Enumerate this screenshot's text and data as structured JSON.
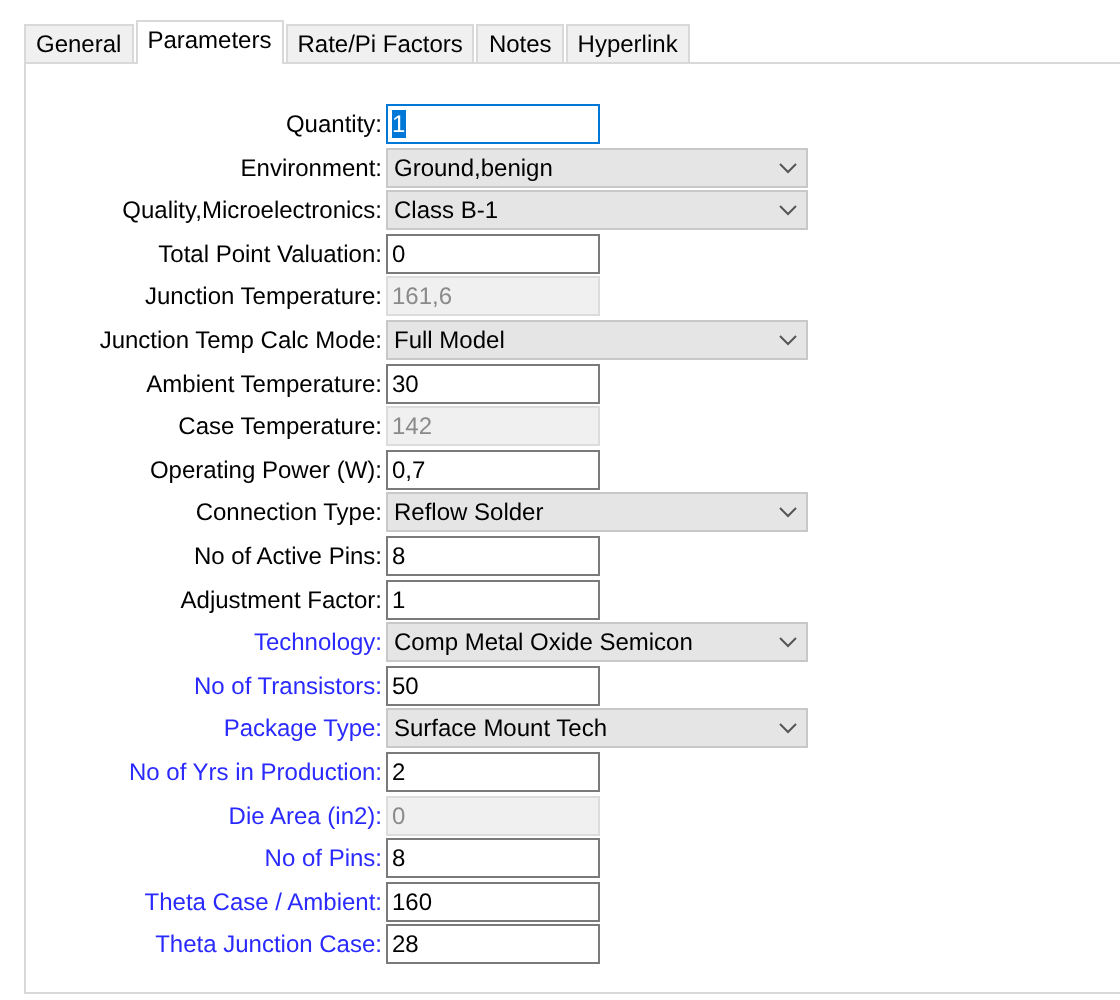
{
  "tabs": [
    {
      "label": "General",
      "selected": false
    },
    {
      "label": "Parameters",
      "selected": true
    },
    {
      "label": "Rate/Pi Factors",
      "selected": false
    },
    {
      "label": "Notes",
      "selected": false
    },
    {
      "label": "Hyperlink",
      "selected": false
    }
  ],
  "fields": [
    {
      "label": "Quantity:",
      "kind": "text",
      "value": "1",
      "highlighted": false,
      "focused": true
    },
    {
      "label": "Environment:",
      "kind": "select",
      "value": "Ground,benign",
      "highlighted": false,
      "focused": false
    },
    {
      "label": "Quality,Microelectronics:",
      "kind": "select",
      "value": "Class B-1",
      "highlighted": false,
      "focused": false
    },
    {
      "label": "Total Point Valuation:",
      "kind": "text",
      "value": "0",
      "highlighted": false,
      "focused": false
    },
    {
      "label": "Junction Temperature:",
      "kind": "readonly",
      "value": "161,6",
      "highlighted": false,
      "focused": false
    },
    {
      "label": "Junction Temp Calc Mode:",
      "kind": "select",
      "value": "Full Model",
      "highlighted": false,
      "focused": false
    },
    {
      "label": "Ambient Temperature:",
      "kind": "text",
      "value": "30",
      "highlighted": false,
      "focused": false
    },
    {
      "label": "Case Temperature:",
      "kind": "readonly",
      "value": "142",
      "highlighted": false,
      "focused": false
    },
    {
      "label": "Operating Power (W):",
      "kind": "text",
      "value": "0,7",
      "highlighted": false,
      "focused": false
    },
    {
      "label": "Connection Type:",
      "kind": "select",
      "value": "Reflow Solder",
      "highlighted": false,
      "focused": false
    },
    {
      "label": "No of Active Pins:",
      "kind": "text",
      "value": "8",
      "highlighted": false,
      "focused": false
    },
    {
      "label": "Adjustment Factor:",
      "kind": "text",
      "value": "1",
      "highlighted": false,
      "focused": false
    },
    {
      "label": "Technology:",
      "kind": "select",
      "value": "Comp Metal Oxide Semicon",
      "highlighted": true,
      "focused": false
    },
    {
      "label": "No of Transistors:",
      "kind": "text",
      "value": "50",
      "highlighted": true,
      "focused": false
    },
    {
      "label": "Package Type:",
      "kind": "select",
      "value": "Surface Mount Tech",
      "highlighted": true,
      "focused": false
    },
    {
      "label": "No of Yrs in Production:",
      "kind": "text",
      "value": "2",
      "highlighted": true,
      "focused": false
    },
    {
      "label": "Die Area (in2):",
      "kind": "readonly",
      "value": "0",
      "highlighted": true,
      "focused": false
    },
    {
      "label": "No of Pins:",
      "kind": "text",
      "value": "8",
      "highlighted": true,
      "focused": false
    },
    {
      "label": "Theta Case / Ambient:",
      "kind": "text",
      "value": "160",
      "highlighted": true,
      "focused": false
    },
    {
      "label": "Theta Junction Case:",
      "kind": "text",
      "value": "28",
      "highlighted": true,
      "focused": false
    }
  ]
}
